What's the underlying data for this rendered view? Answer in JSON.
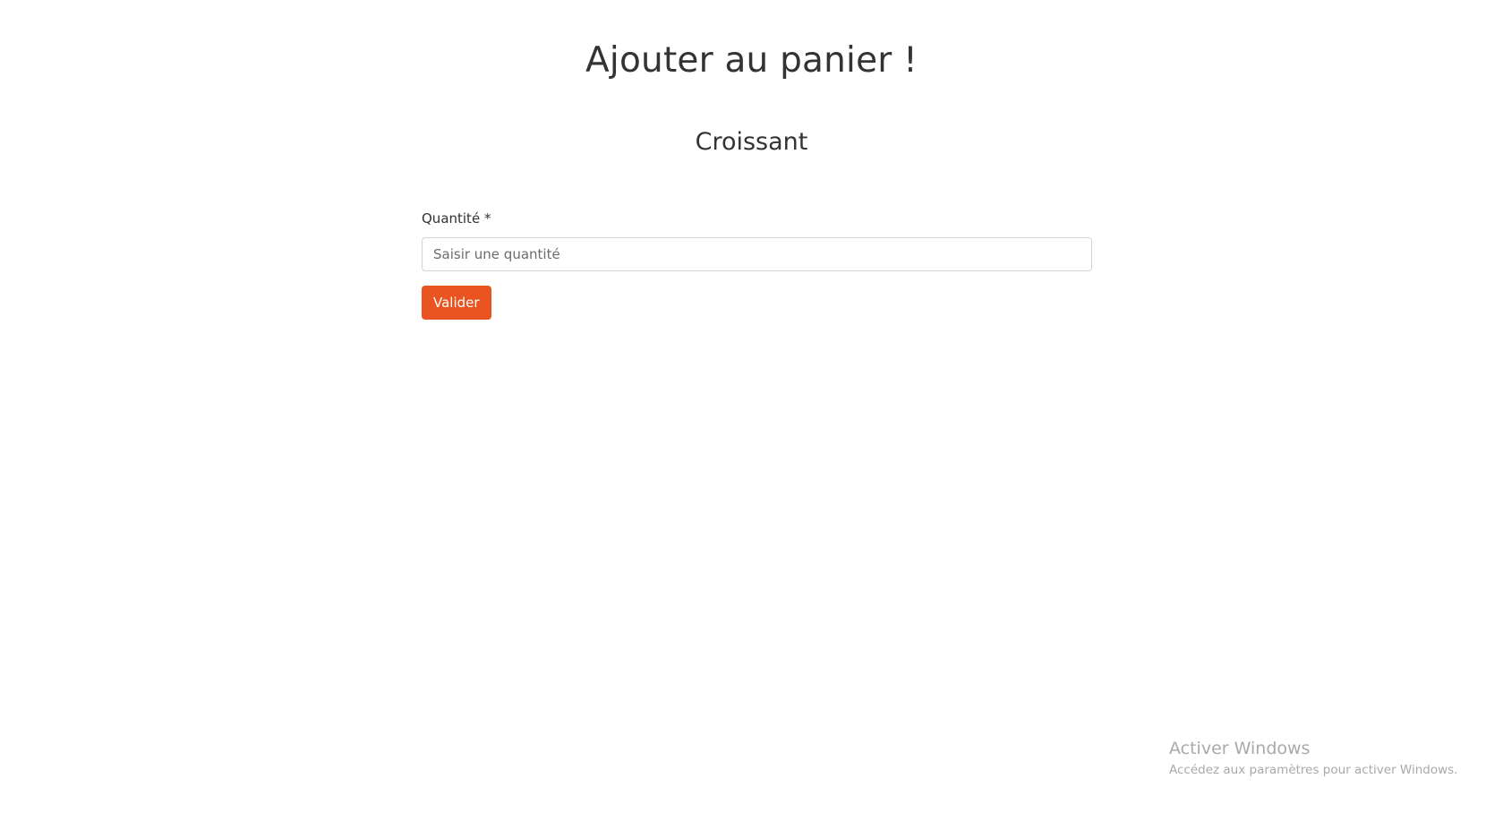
{
  "page": {
    "title": "Ajouter au panier !",
    "product_name": "Croissant"
  },
  "form": {
    "quantity_label": "Quantité *",
    "quantity_value": "",
    "quantity_placeholder": "Saisir une quantité",
    "submit_label": "Valider"
  },
  "watermark": {
    "title": "Activer Windows",
    "subtitle": "Accédez aux paramètres pour activer Windows."
  },
  "colors": {
    "accent": "#e95420",
    "text": "#333333",
    "input_border": "#cfd4da",
    "watermark": "#a9a9a9"
  }
}
